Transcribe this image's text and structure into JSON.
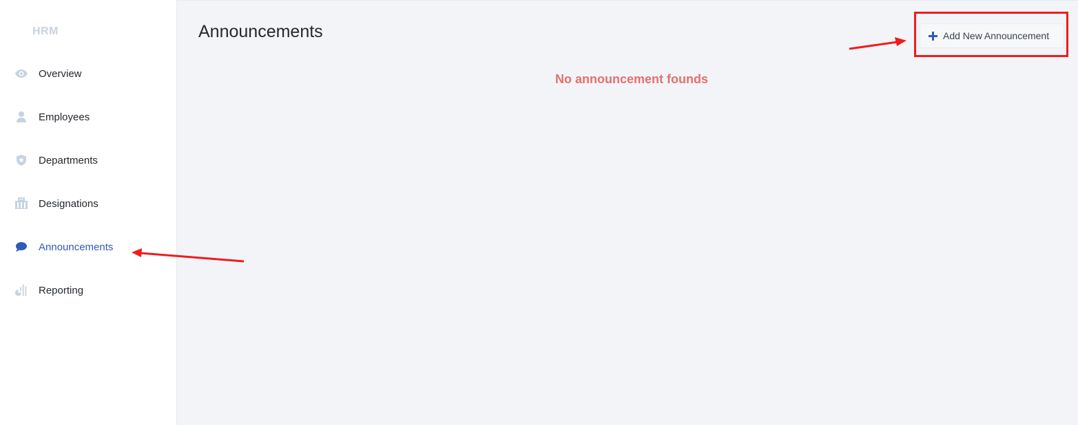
{
  "sidebar": {
    "brand": "HRM",
    "items": [
      {
        "label": "Overview",
        "icon": "eye-icon"
      },
      {
        "label": "Employees",
        "icon": "user-icon"
      },
      {
        "label": "Departments",
        "icon": "shield-star-icon"
      },
      {
        "label": "Designations",
        "icon": "building-icon"
      },
      {
        "label": "Announcements",
        "icon": "speech-bubble-icon",
        "active": true
      },
      {
        "label": "Reporting",
        "icon": "bar-pie-chart-icon"
      }
    ]
  },
  "main": {
    "title": "Announcements",
    "add_button_label": "Add New Announcement",
    "empty_message": "No announcement founds"
  },
  "colors": {
    "accent": "#2f5bb8",
    "icon_muted": "#c7d3e0",
    "empty_message": "#e46f6f",
    "annotation_red": "#ee1c1c",
    "main_bg": "#f3f4f8"
  }
}
